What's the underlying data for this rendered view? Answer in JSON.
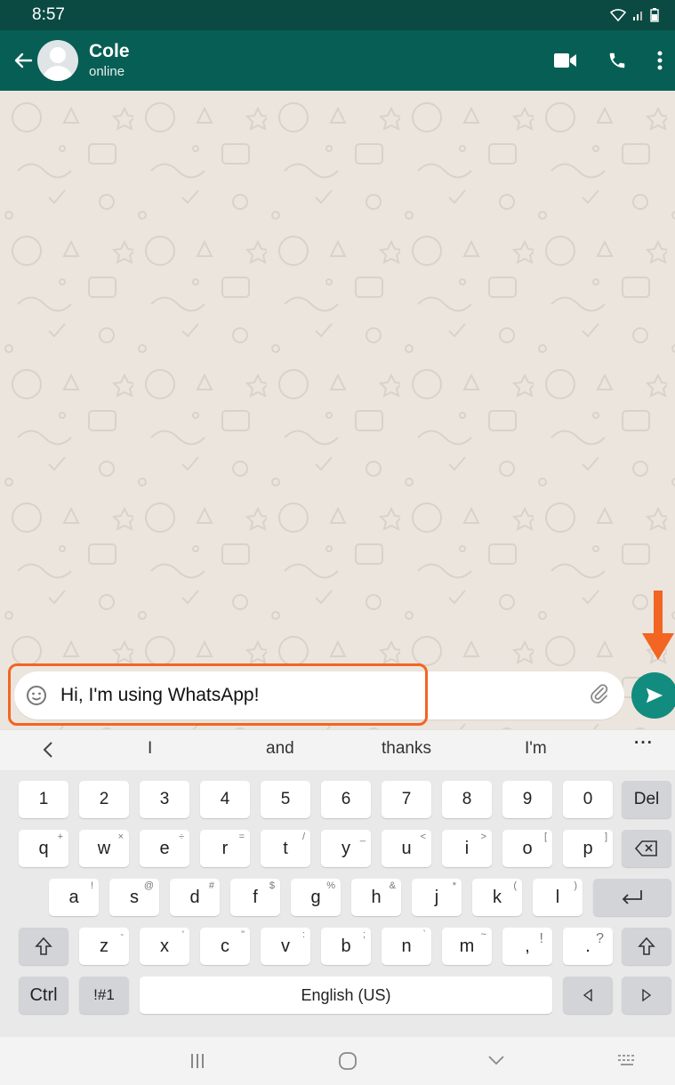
{
  "status_bar": {
    "time": "8:57"
  },
  "header": {
    "contact_name": "Cole",
    "contact_status": "online"
  },
  "composer": {
    "message_text": "Hi, I'm using WhatsApp!"
  },
  "suggestions": {
    "items": [
      "I",
      "and",
      "thanks",
      "I'm"
    ]
  },
  "keyboard": {
    "row_numbers": [
      "1",
      "2",
      "3",
      "4",
      "5",
      "6",
      "7",
      "8",
      "9",
      "0"
    ],
    "del_label": "Del",
    "row_q": [
      {
        "k": "q",
        "s": "+"
      },
      {
        "k": "w",
        "s": "×"
      },
      {
        "k": "e",
        "s": "÷"
      },
      {
        "k": "r",
        "s": "="
      },
      {
        "k": "t",
        "s": "/"
      },
      {
        "k": "y",
        "s": "_"
      },
      {
        "k": "u",
        "s": "<"
      },
      {
        "k": "i",
        "s": ">"
      },
      {
        "k": "o",
        "s": "["
      },
      {
        "k": "p",
        "s": "]"
      }
    ],
    "row_a": [
      {
        "k": "a",
        "s": "!"
      },
      {
        "k": "s",
        "s": "@"
      },
      {
        "k": "d",
        "s": "#"
      },
      {
        "k": "f",
        "s": "$"
      },
      {
        "k": "g",
        "s": "%"
      },
      {
        "k": "h",
        "s": "&"
      },
      {
        "k": "j",
        "s": "*"
      },
      {
        "k": "k",
        "s": "("
      },
      {
        "k": "l",
        "s": ")"
      }
    ],
    "row_z": [
      {
        "k": "z",
        "s": "-"
      },
      {
        "k": "x",
        "s": "'"
      },
      {
        "k": "c",
        "s": "\""
      },
      {
        "k": "v",
        "s": ":"
      },
      {
        "k": "b",
        "s": ";"
      },
      {
        "k": "n",
        "s": "`"
      },
      {
        "k": "m",
        "s": "~"
      },
      {
        "k": ",",
        "s": "!"
      },
      {
        "k": ".",
        "s": "?"
      }
    ],
    "ctrl_label": "Ctrl",
    "symbols_label": "!#1",
    "space_label": "English (US)"
  },
  "colors": {
    "header": "#075e54",
    "status_bar": "#0a4a42",
    "send_button": "#128c7e",
    "highlight": "#f26522"
  }
}
